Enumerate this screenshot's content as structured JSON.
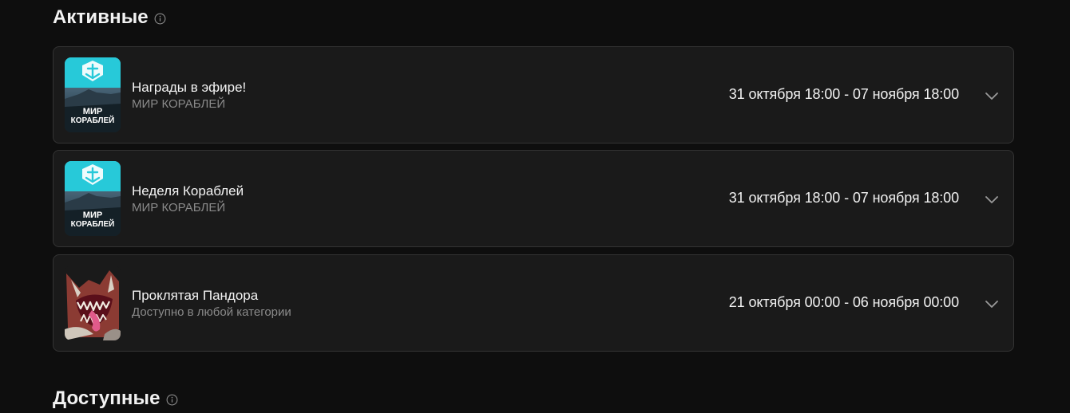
{
  "sections": {
    "active": {
      "title": "Активные"
    },
    "available": {
      "title": "Доступные"
    }
  },
  "cards": [
    {
      "title": "Награды в эфире!",
      "subtitle": "МИР КОРАБЛЕЙ",
      "date": "31 октября 18:00 - 07 ноября 18:00",
      "thumb_text_1": "МИР",
      "thumb_text_2": "КОРАБЛЕЙ",
      "icon": "chevron-down-icon"
    },
    {
      "title": "Неделя Кораблей",
      "subtitle": "МИР КОРАБЛЕЙ",
      "date": "31 октября 18:00 - 07 ноября 18:00",
      "thumb_text_1": "МИР",
      "thumb_text_2": "КОРАБЛЕЙ",
      "icon": "chevron-down-icon"
    },
    {
      "title": "Проклятая Пандора",
      "subtitle": "Доступно в любой категории",
      "date": "21 октября 00:00 - 06 ноября 00:00",
      "icon": "chevron-down-icon"
    }
  ],
  "colors": {
    "background": "#0e0e0e",
    "card": "#1a1a1a",
    "card_border": "#333333",
    "wows_cyan": "#27c9d9",
    "muted_text": "#8a8a8a"
  }
}
